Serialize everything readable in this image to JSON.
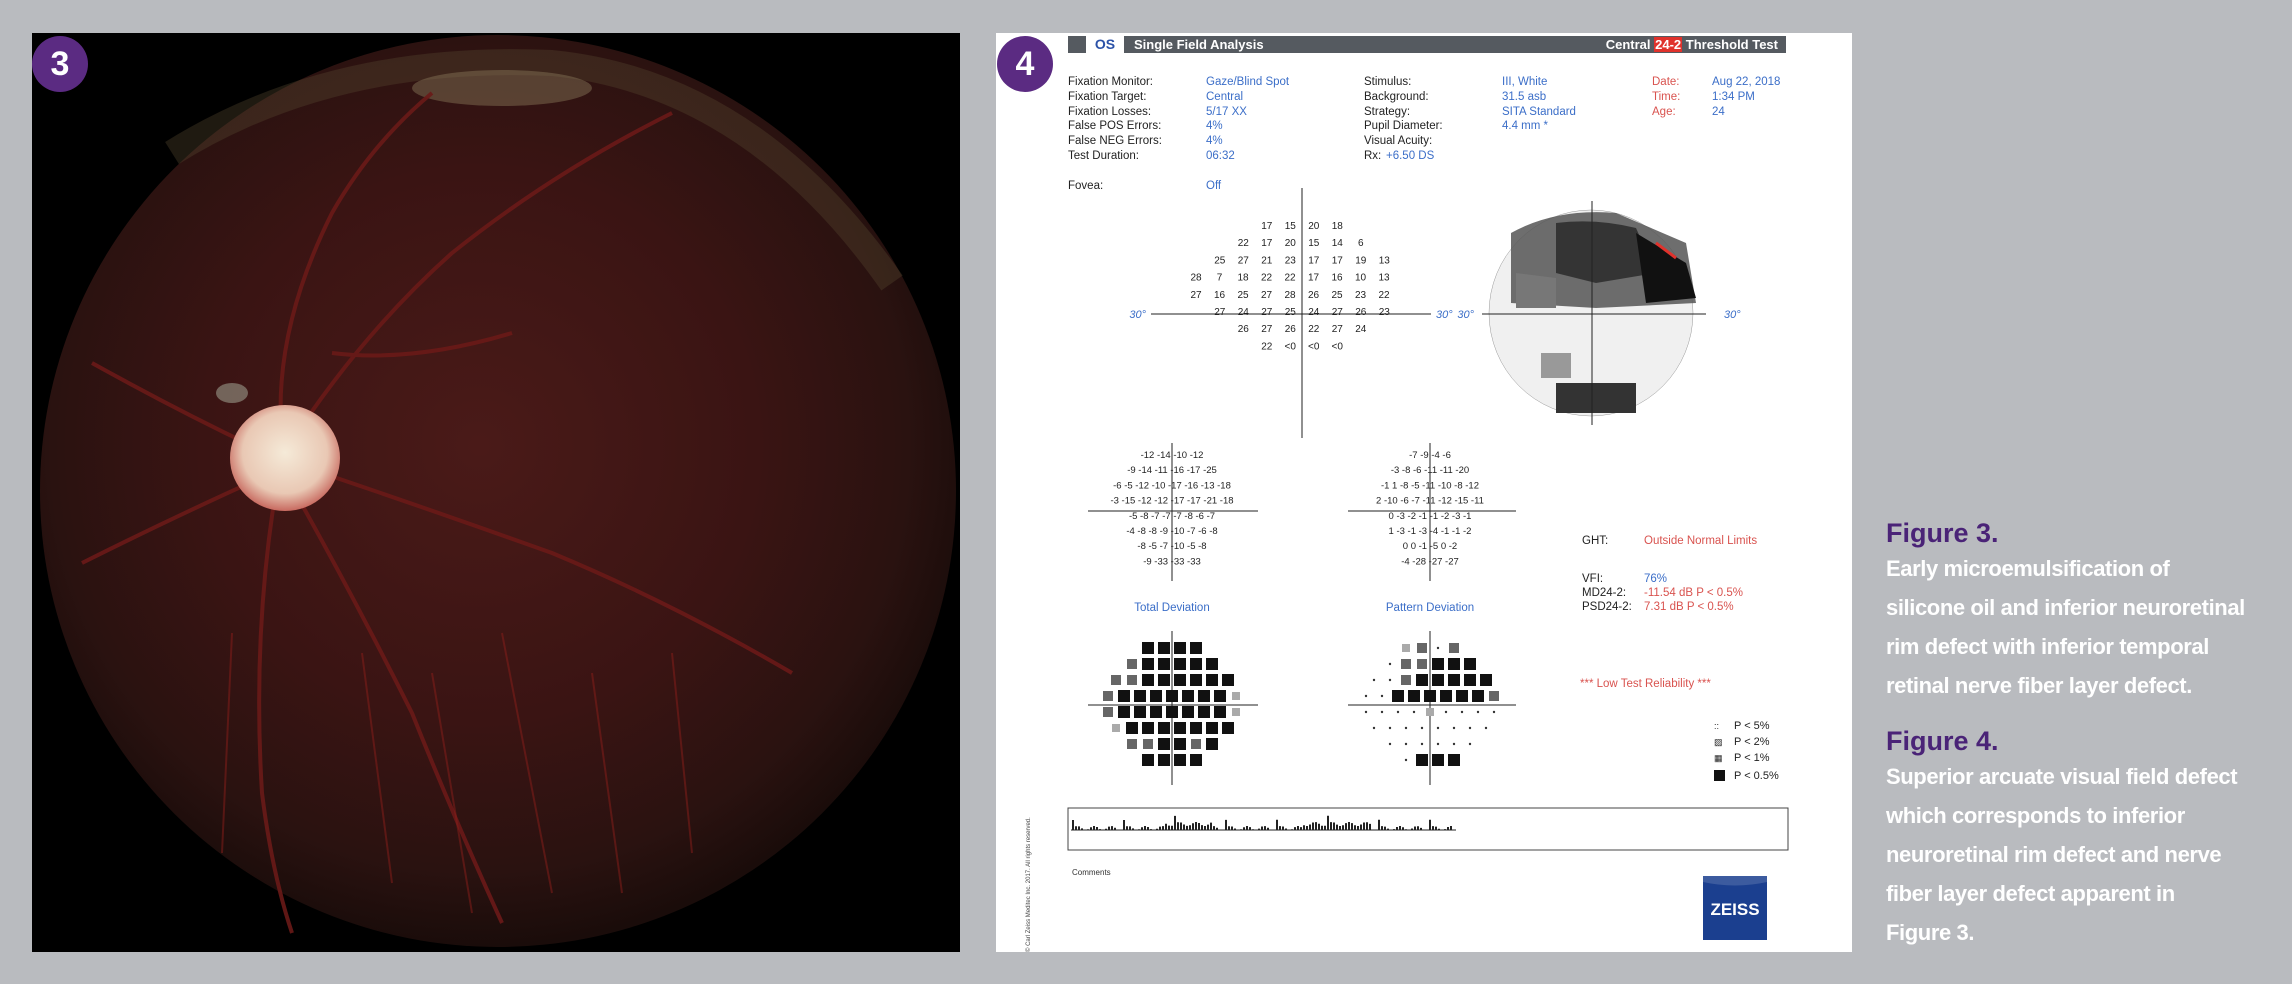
{
  "figure3": {
    "badge": "3"
  },
  "figure4": {
    "badge": "4",
    "header": {
      "eye": "OS",
      "title": "Single Field Analysis",
      "test_prefix": "Central ",
      "test_highlight": "24-2",
      "test_suffix": " Threshold Test"
    },
    "info_col1": [
      {
        "label": "Fixation Monitor:",
        "value": "Gaze/Blind Spot"
      },
      {
        "label": "Fixation Target:",
        "value": "Central"
      },
      {
        "label": "Fixation Losses:",
        "value": "5/17 XX"
      },
      {
        "label": "False POS Errors:",
        "value": "4%"
      },
      {
        "label": "False NEG Errors:",
        "value": "4%"
      },
      {
        "label": "Test Duration:",
        "value": "06:32"
      },
      {
        "label": "",
        "value": ""
      },
      {
        "label": "Fovea:",
        "value": "Off"
      }
    ],
    "info_col2": [
      {
        "label": "Stimulus:",
        "value": "III, White"
      },
      {
        "label": "Background:",
        "value": "31.5 asb"
      },
      {
        "label": "Strategy:",
        "value": "SITA Standard"
      },
      {
        "label": "Pupil Diameter:",
        "value": "4.4 mm *"
      },
      {
        "label": "Visual Acuity:",
        "value": ""
      },
      {
        "label": "Rx:",
        "value": "+6.50 DS"
      }
    ],
    "info_col3": [
      {
        "label": "Date:",
        "value": "Aug 22, 2018"
      },
      {
        "label": "Time:",
        "value": "1:34 PM"
      },
      {
        "label": "Age:",
        "value": "24"
      }
    ],
    "axis_label": "30°",
    "threshold_rows": [
      [
        "17",
        "15",
        "20",
        "18"
      ],
      [
        "22",
        "17",
        "20",
        "15",
        "14",
        "6"
      ],
      [
        "25",
        "27",
        "21",
        "23",
        "17",
        "17",
        "19",
        "13"
      ],
      [
        "28",
        "7",
        "18",
        "22",
        "22",
        "17",
        "16",
        "10",
        "13"
      ],
      [
        "27",
        "16",
        "25",
        "27",
        "28",
        "26",
        "25",
        "23",
        "22"
      ],
      [
        "27",
        "24",
        "27",
        "25",
        "24",
        "27",
        "26",
        "23"
      ],
      [
        "26",
        "27",
        "26",
        "22",
        "27",
        "24"
      ],
      [
        "22",
        "<0",
        "<0",
        "<0"
      ]
    ],
    "total_deviation_rows": [
      "-12 -14 -10 -12",
      "-9 -14 -11 -16 -17 -25",
      "-6 -5 -12 -10 -17 -16 -13 -18",
      "-3   -15 -12 -12 -17 -17 -21 -18",
      "-5   -8 -7 -7 -7 -8 -6 -7",
      "-4 -8 -8 -9 -10 -7 -6 -8",
      "-8 -5 -7 -10 -5 -8",
      "-9 -33 -33 -33"
    ],
    "pattern_deviation_rows": [
      "-7 -9 -4 -6",
      "-3 -8 -6 -11 -11 -20",
      "-1 1 -8 -5 -11 -10 -8 -12",
      "2   -10 -6 -7 -11 -12 -15 -11",
      "0   -3 -2 -1 -1 -2 -3 -1",
      "1 -3 -1 -3 -4 -1 -1 -2",
      "0 0 -1 -5 0 -2",
      "-4 -28 -27 -27"
    ],
    "total_deviation_label": "Total Deviation",
    "pattern_deviation_label": "Pattern Deviation",
    "ght_label": "GHT:",
    "ght_value": "Outside Normal Limits",
    "vfi_label": "VFI:",
    "vfi_value": "76%",
    "md_label": "MD24-2:",
    "md_value": "-11.54 dB P < 0.5%",
    "psd_label": "PSD24-2:",
    "psd_value": "7.31 dB P < 0.5%",
    "reliability": "*** Low Test Reliability ***",
    "legend": [
      "P < 5%",
      "P < 2%",
      "P < 1%",
      "P < 0.5%"
    ],
    "comments_label": "Comments",
    "logo": "ZEISS",
    "copyright": "© Carl Zeiss Meditec Inc. 2017. All rights reserved."
  },
  "captions": [
    {
      "title": "Figure 3.",
      "lines": [
        "Early microemulsification of",
        "silicone oil and inferior neuroretinal",
        "rim defect with inferior temporal",
        "retinal nerve fiber layer defect."
      ]
    },
    {
      "title": "Figure 4.",
      "lines": [
        "Superior arcuate visual field defect",
        "which corresponds to inferior",
        "neuroretinal rim defect and nerve",
        "fiber layer defect apparent in",
        "Figure 3."
      ]
    }
  ],
  "colors": {
    "background": "#b9bbbf",
    "badge": "#5b2b82",
    "caption_title": "#4a2377",
    "report_blue": "#3b6ec8",
    "report_red": "#d9534f"
  }
}
